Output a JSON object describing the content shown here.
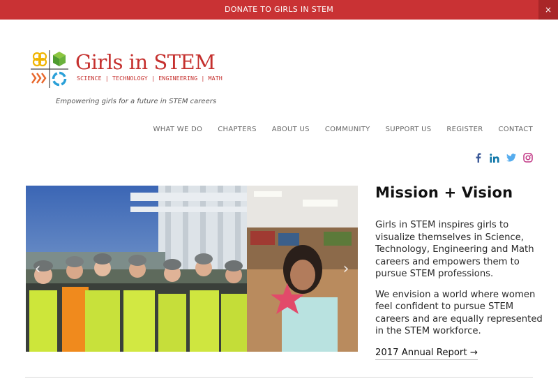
{
  "topbar": {
    "donate_label": "DONATE TO GIRLS IN STEM",
    "close_label": "×",
    "color": "#c93234"
  },
  "logo": {
    "title": "Girls in STEM",
    "subtitle": "SCIENCE | TECHNOLOGY | ENGINEERING | MATH",
    "tagline": "Empowering girls for a future in STEM careers",
    "brand_color": "#c5302e"
  },
  "nav": {
    "items": [
      {
        "label": "WHAT WE DO"
      },
      {
        "label": "CHAPTERS"
      },
      {
        "label": "ABOUT US"
      },
      {
        "label": "COMMUNITY"
      },
      {
        "label": "SUPPORT US"
      },
      {
        "label": "REGISTER"
      },
      {
        "label": "CONTACT"
      }
    ]
  },
  "social": {
    "icons": [
      "facebook-icon",
      "linkedin-icon",
      "twitter-icon",
      "instagram-icon"
    ]
  },
  "slider": {
    "prev_label": "‹",
    "next_label": "›"
  },
  "mission": {
    "heading": "Mission + Vision",
    "paragraph_1": "Girls in STEM inspires girls to visualize themselves in Science, Technology, Engineering and Math careers and empowers them to pursue STEM professions.",
    "paragraph_2": "We envision a world where women feel confident to pursue STEM careers and are equally represented in the STEM workforce.",
    "report_link": "2017 Annual Report →"
  }
}
